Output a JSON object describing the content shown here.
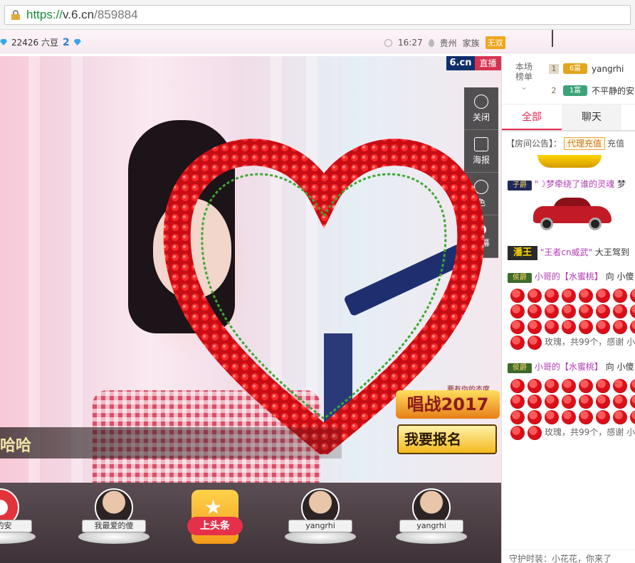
{
  "browser": {
    "url_scheme": "https://",
    "url_host": "v.6.cn",
    "url_path": "/859884"
  },
  "info_strip": {
    "beans": "22426 六豆",
    "diamonds": "2",
    "time": "16:27",
    "location": "贵州",
    "family_label": "家族",
    "family_tag": "无双"
  },
  "video": {
    "logo_left": "6.cn",
    "logo_right": "直播",
    "tools": [
      {
        "label": "关闭",
        "icon": "power-icon"
      },
      {
        "label": "海报",
        "icon": "poster-icon"
      },
      {
        "label": "色",
        "icon": "color-icon"
      },
      {
        "label": "弹幕",
        "icon": "barrage-icon"
      }
    ],
    "name_text": "哈哈",
    "promo_small": "要有你的态度",
    "promo_title": "唱战2017",
    "promo_button": "我要报名"
  },
  "bottom": {
    "slots": [
      {
        "label": "静的安"
      },
      {
        "label": "我最爱的傻"
      },
      {
        "label": "上头条"
      },
      {
        "label": "yangrhi"
      },
      {
        "label": "yangrhi"
      }
    ]
  },
  "ranking": {
    "side_label_1": "本场",
    "side_label_2": "榜单",
    "rows": [
      {
        "no": "1",
        "badge": "6富",
        "name": "yangrhi"
      },
      {
        "no": "2",
        "badge": "1富",
        "name": "不平静的安"
      }
    ]
  },
  "tabs": [
    {
      "label": "全部"
    },
    {
      "label": "聊天"
    }
  ],
  "notice": {
    "prefix": "【房间公告】：",
    "button": "代理充值",
    "suffix": "充值"
  },
  "messages": [
    {
      "vip": "子爵",
      "text": "\"☽梦牵绕了谁的灵魂",
      "tail": "梦"
    },
    {
      "vip": "潘王",
      "text": "\"王者cn威武\"",
      "tail": "大王驾到"
    },
    {
      "vip": "侯爵",
      "text": "小哥的【水蜜桃】",
      "tail": "向 小傻",
      "gift": "玫瑰，共99个，感谢 小"
    },
    {
      "vip": "侯爵",
      "text": "小哥的【水蜜桃】",
      "tail": "向 小傻",
      "gift": "玫瑰，共99个，感谢 小"
    }
  ],
  "footer": "守护时装：小花花，你来了"
}
